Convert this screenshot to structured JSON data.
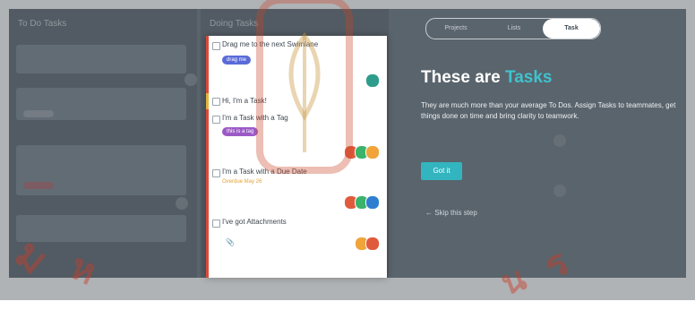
{
  "background_app": {
    "columns": [
      {
        "header": "To Do Tasks"
      },
      {
        "header": "Doing Tasks"
      }
    ]
  },
  "tasks": [
    {
      "title": "Drag me to the next Swimlane",
      "tag": "drag me",
      "tag_color": "#5a6bd8",
      "bar_color": "#d94a3a",
      "avatars": [
        "#2e9c8a"
      ]
    },
    {
      "title": "Hi, I'm a Task!",
      "bar_color": "#e0b43c",
      "avatars": []
    },
    {
      "title": "I'm a Task with a Tag",
      "tag": "this is a tag",
      "tag_color": "#9b59c6",
      "bar_color": "#d94a3a",
      "avatars": [
        "#e05a3c",
        "#3bb36b",
        "#f0a43a"
      ]
    },
    {
      "title": "I'm a Task with a Due Date",
      "due": "Overdue May 26",
      "bar_color": "#d94a3a",
      "avatars": [
        "#e05a3c",
        "#3bb36b",
        "#2f7fd1"
      ]
    },
    {
      "title": "I've got Attachments",
      "attachment_icon": "paperclip-icon",
      "bar_color": "#d94a3a",
      "avatars": [
        "#f0a43a",
        "#e05a3c"
      ]
    }
  ],
  "stepper": {
    "steps": [
      "Projects",
      "Lists",
      "Task"
    ],
    "active": 2
  },
  "intro": {
    "headline_white": "These are",
    "headline_accent": "Tasks",
    "accent_color": "#3ec3cf",
    "description": "They are much more than your average To Dos. Assign Tasks to teammates, get things done on time and bring clarity to teamwork.",
    "cta": "Got it",
    "skip": "Skip this step"
  }
}
